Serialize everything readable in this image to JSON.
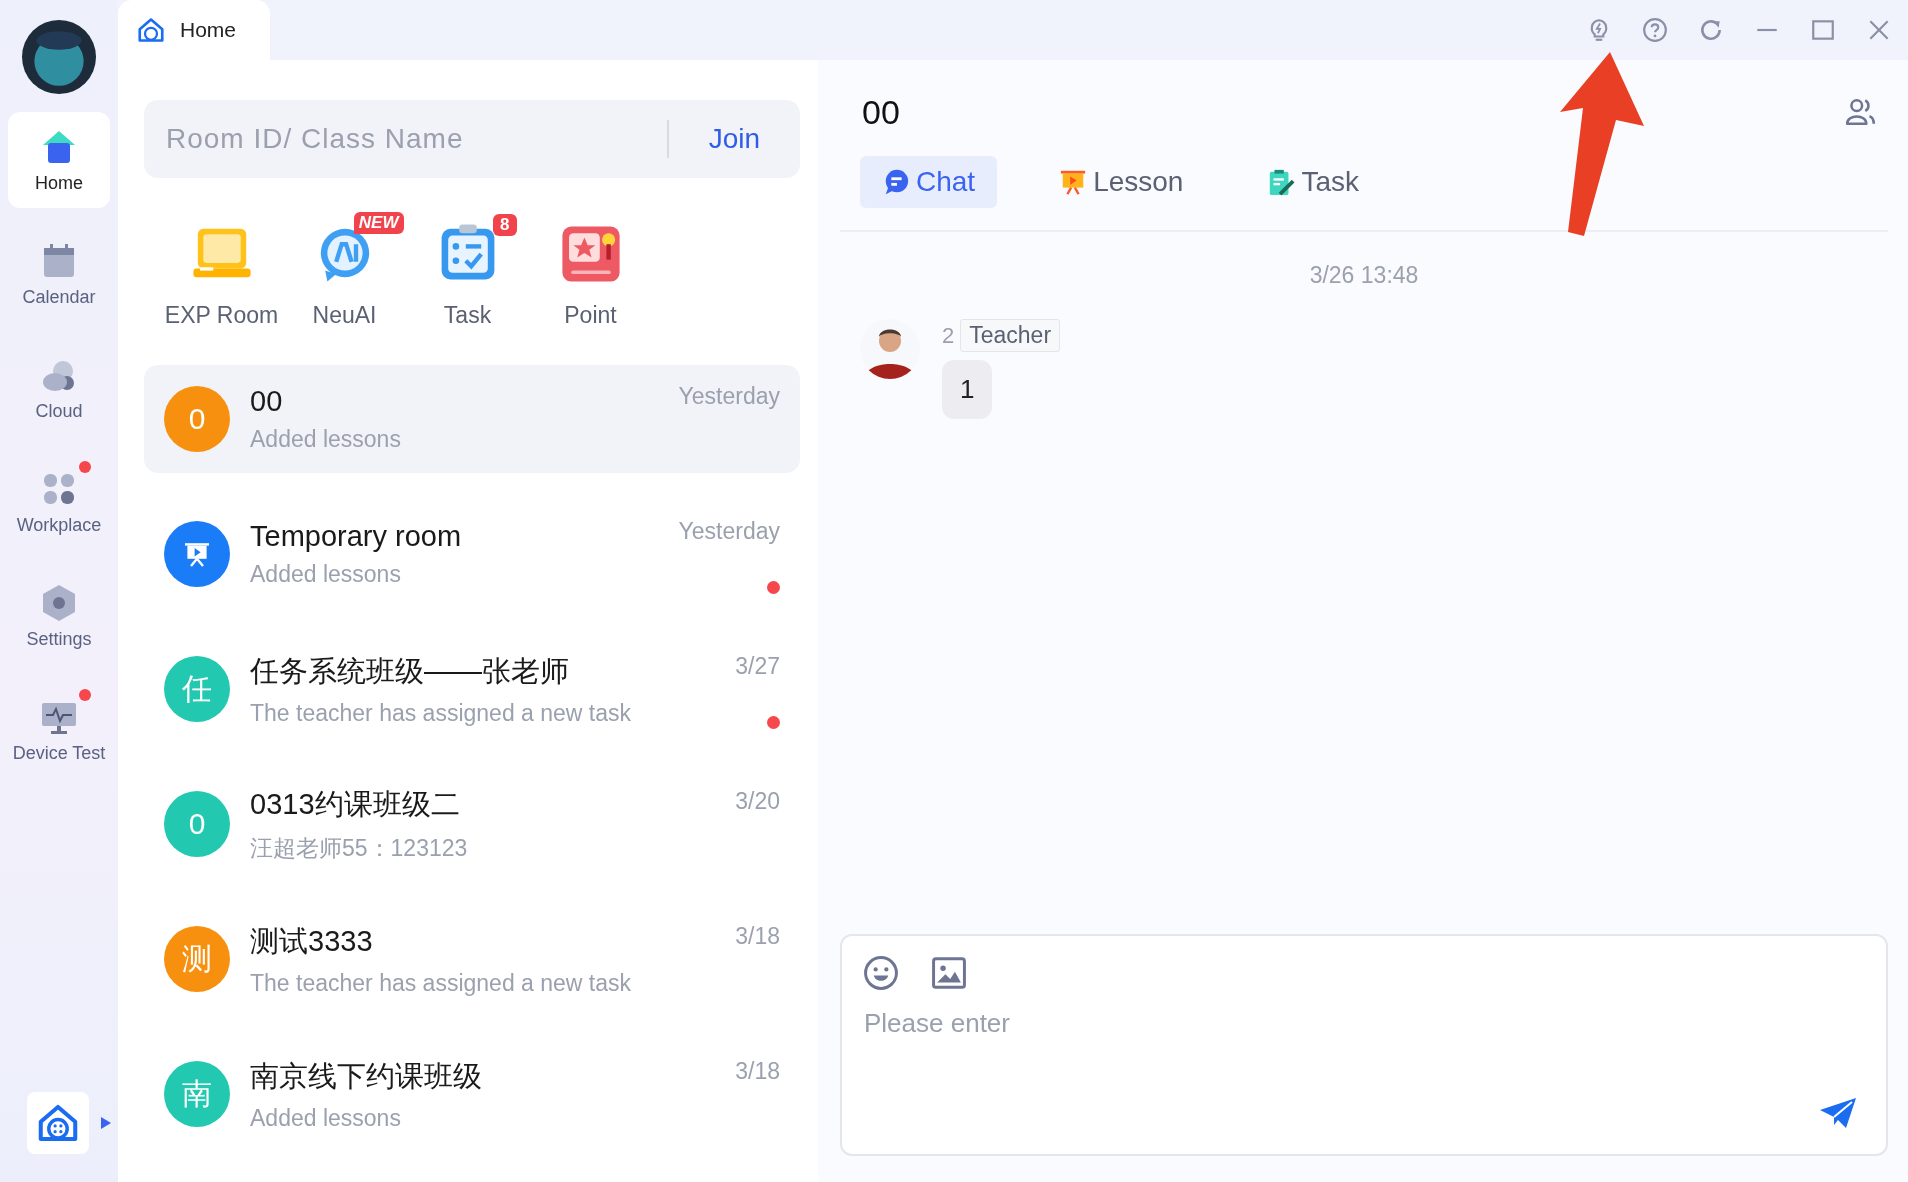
{
  "sidebar": {
    "items": [
      {
        "label": "Home",
        "kind": "home",
        "selected": true,
        "badge": false
      },
      {
        "label": "Calendar",
        "kind": "calendar",
        "selected": false,
        "badge": false
      },
      {
        "label": "Cloud",
        "kind": "cloud",
        "selected": false,
        "badge": false
      },
      {
        "label": "Workplace",
        "kind": "workplace",
        "selected": false,
        "badge": true
      },
      {
        "label": "Settings",
        "kind": "settings",
        "selected": false,
        "badge": false
      },
      {
        "label": "Device Test",
        "kind": "device",
        "selected": false,
        "badge": true
      }
    ]
  },
  "tabs": [
    {
      "label": "Home",
      "selected": true
    }
  ],
  "search": {
    "placeholder": "Room ID/ Class Name",
    "button": "Join"
  },
  "shortcuts": [
    {
      "label": "EXP Room",
      "kind": "exp"
    },
    {
      "label": "NeuAI",
      "kind": "ai",
      "badge": {
        "text": "NEW",
        "kind": "new"
      }
    },
    {
      "label": "Task",
      "kind": "task",
      "badge": {
        "text": "8",
        "kind": "count"
      }
    },
    {
      "label": "Point",
      "kind": "point"
    }
  ],
  "conversations": [
    {
      "kind": "letter",
      "avatar": "0",
      "color": "#f7900f",
      "name": "00",
      "preview": "Added lessons",
      "time": "Yesterday",
      "unread": false,
      "selected": true
    },
    {
      "kind": "room",
      "color": "#1a7cf7",
      "name": "Temporary room",
      "preview": "Added lessons",
      "time": "Yesterday",
      "unread": true,
      "selected": false
    },
    {
      "kind": "letter",
      "avatar": "任",
      "color": "#22c9b0",
      "name": "任务系统班级——张老师",
      "preview": "The teacher has assigned a new task",
      "time": "3/27",
      "unread": true,
      "selected": false
    },
    {
      "kind": "letter",
      "avatar": "0",
      "color": "#22c9b0",
      "name": "0313约课班级二",
      "preview": "汪超老师55：123123",
      "time": "3/20",
      "unread": false,
      "selected": false
    },
    {
      "kind": "letter",
      "avatar": "测",
      "color": "#f7900f",
      "name": "测试3333",
      "preview": "The teacher has assigned a new task",
      "time": "3/18",
      "unread": false,
      "selected": false
    },
    {
      "kind": "letter",
      "avatar": "南",
      "color": "#22c9b0",
      "name": "南京线下约课班级",
      "preview": "Added lessons",
      "time": "3/18",
      "unread": false,
      "selected": false
    }
  ],
  "chat": {
    "title": "00",
    "tabs": [
      {
        "label": "Chat",
        "kind": "chat",
        "selected": true
      },
      {
        "label": "Lesson",
        "kind": "lesson",
        "selected": false
      },
      {
        "label": "Task",
        "kind": "task",
        "selected": false
      }
    ],
    "timestamp": "3/26 13:48",
    "messages": [
      {
        "sender": "2",
        "role": "Teacher",
        "text": "1"
      }
    ],
    "input": {
      "placeholder": "Please enter"
    }
  }
}
